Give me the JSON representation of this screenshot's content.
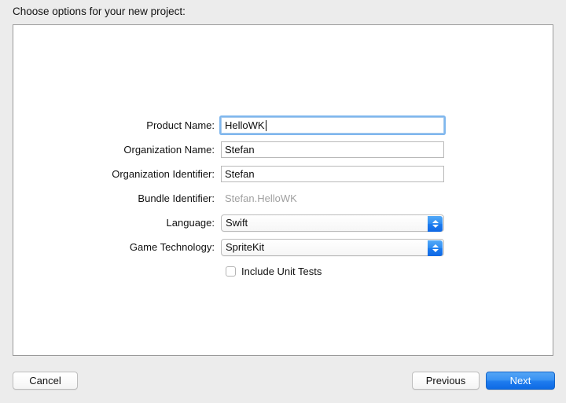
{
  "header": {
    "prompt": "Choose options for your new project:"
  },
  "form": {
    "fields": [
      {
        "label": "Product Name:",
        "value": "HelloWK",
        "type": "textfield",
        "focused": true
      },
      {
        "label": "Organization Name:",
        "value": "Stefan",
        "type": "textfield",
        "focused": false
      },
      {
        "label": "Organization Identifier:",
        "value": "Stefan",
        "type": "textfield",
        "focused": false
      },
      {
        "label": "Bundle Identifier:",
        "value": "Stefan.HelloWK",
        "type": "static",
        "focused": false
      },
      {
        "label": "Language:",
        "value": "Swift",
        "type": "popup",
        "focused": false
      },
      {
        "label": "Game Technology:",
        "value": "SpriteKit",
        "type": "popup",
        "focused": false
      }
    ],
    "checkbox": {
      "label": "Include Unit Tests",
      "checked": false
    }
  },
  "footer": {
    "cancel_label": "Cancel",
    "previous_label": "Previous",
    "next_label": "Next"
  },
  "icons": {
    "popup_stepper": "chevron-up-down-icon"
  },
  "colors": {
    "window_background": "#ececec",
    "panel_background": "#ffffff",
    "panel_border": "#9a9a9a",
    "accent_blue": "#1f7cee",
    "focus_ring": "#7fb7ee",
    "disabled_text": "#a0a0a0"
  }
}
